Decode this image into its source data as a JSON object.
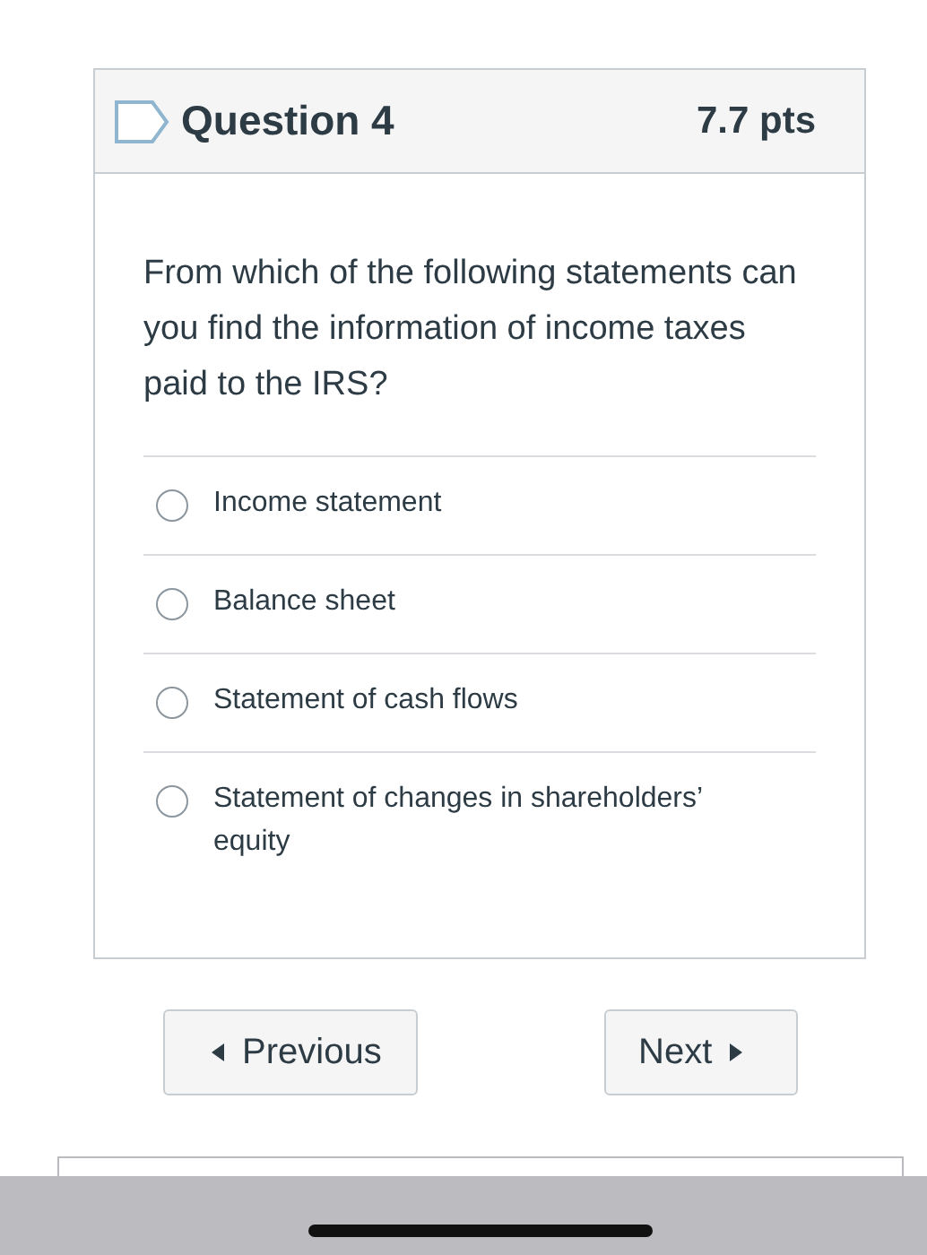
{
  "question": {
    "title": "Question 4",
    "points": "7.7 pts",
    "flagged": false,
    "text": "From which of the following statements can you find the information of income taxes paid to the IRS?",
    "options": [
      {
        "label": "Income statement",
        "selected": false
      },
      {
        "label": "Balance sheet",
        "selected": false
      },
      {
        "label": "Statement of cash flows",
        "selected": false
      },
      {
        "label": "Statement of changes in shareholders’ equity",
        "selected": false
      }
    ]
  },
  "navigation": {
    "previous": "Previous",
    "next": "Next"
  }
}
